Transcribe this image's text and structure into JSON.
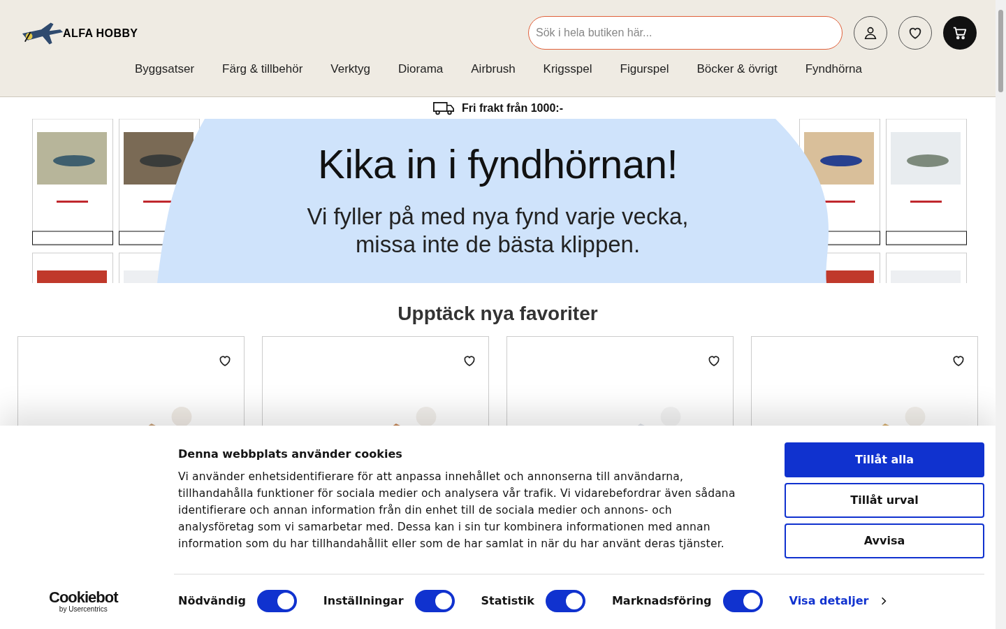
{
  "header": {
    "logo_text": "ALFA HOBBY",
    "search": {
      "placeholder": "Sök i hela butiken här..."
    }
  },
  "nav": {
    "items": [
      "Byggsatser",
      "Färg & tillbehör",
      "Verktyg",
      "Diorama",
      "Airbrush",
      "Krigsspel",
      "Figurspel",
      "Böcker & övrigt",
      "Fyndhörna"
    ]
  },
  "shipping_bar": {
    "text": "Fri frakt från 1000:-"
  },
  "banner": {
    "headline": "Kika in i fyndhörnan!",
    "subline": "Vi fyller på med nya fynd varje vecka, missa inte de bästa klippen."
  },
  "products": {
    "heading": "Upptäck nya favoriter"
  },
  "cookie_banner": {
    "title": "Denna webbplats använder cookies",
    "text": "Vi använder enhetsidentifierare för att anpassa innehållet och annonserna till användarna, tillhandahålla funktioner för sociala medier och analysera vår trafik. Vi vidarebefordrar även sådana identifierare och annan information från din enhet till de sociala medier och annons- och analysföretag som vi samarbetar med. Dessa kan i sin tur kombinera informationen med annan information som du har tillhandahållit eller som de har samlat in när du har använt deras tjänster.",
    "buttons": [
      {
        "label": "Tillåt alla",
        "kind": "primary"
      },
      {
        "label": "Tillåt urval",
        "kind": "outline"
      },
      {
        "label": "Avvisa",
        "kind": "outline"
      }
    ],
    "brand": {
      "name": "Cookiebot",
      "tagline": "by Usercentrics"
    },
    "toggles": [
      {
        "label": "Nödvändig",
        "checked": true
      },
      {
        "label": "Inställningar",
        "checked": true
      },
      {
        "label": "Statistik",
        "checked": true
      },
      {
        "label": "Marknadsföring",
        "checked": true
      }
    ],
    "details_link": "Visa detaljer"
  }
}
